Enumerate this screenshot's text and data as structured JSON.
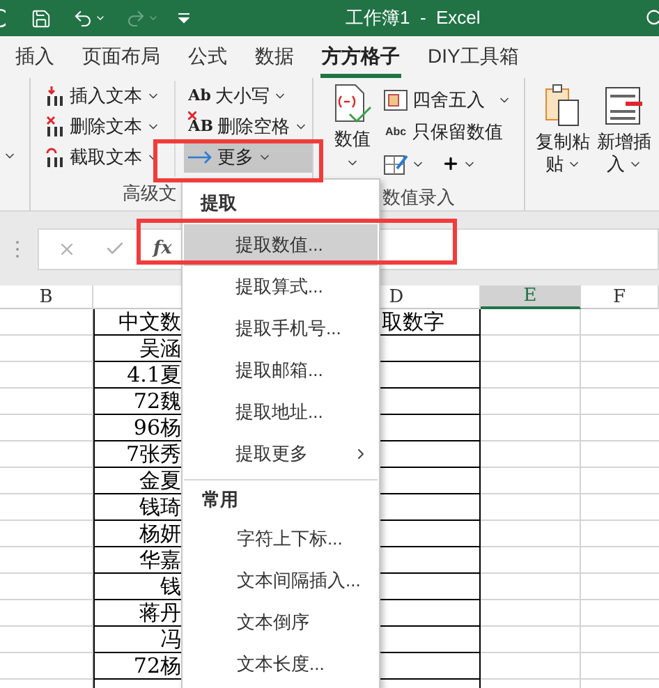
{
  "title_bar": {
    "title": "工作簿1  -  Excel"
  },
  "tabs": [
    {
      "label": "插入",
      "selected": false
    },
    {
      "label": "页面布局",
      "selected": false
    },
    {
      "label": "公式",
      "selected": false
    },
    {
      "label": "数据",
      "selected": false
    },
    {
      "label": "方方格子",
      "selected": true
    },
    {
      "label": "DIY工具箱",
      "selected": false
    }
  ],
  "ribbon": {
    "text_group": {
      "label": "高级文",
      "columns": [
        [
          {
            "label": "插入文本",
            "dropdown": true,
            "pressed": false
          },
          {
            "label": "删除文本",
            "dropdown": true,
            "pressed": false
          },
          {
            "label": "截取文本",
            "dropdown": true,
            "pressed": false
          }
        ],
        [
          {
            "label": "大小写",
            "icon_text": "Ab",
            "dropdown": true,
            "pressed": false
          },
          {
            "label": "删除空格",
            "icon_text": "AB",
            "dropdown": true,
            "pressed": false
          },
          {
            "label": "更多",
            "dropdown": true,
            "pressed": true
          }
        ]
      ]
    },
    "number_group": {
      "label": "数值录入",
      "big_button": {
        "label": "数值",
        "dropdown": true
      },
      "items": [
        {
          "label": "四舍五入",
          "dropdown": true
        },
        {
          "label": "只保留数值",
          "icon_text": "Abc",
          "dropdown": false
        }
      ]
    },
    "clipboard_group": {
      "buttons": [
        {
          "lines": [
            "复制粘",
            "贴"
          ],
          "dropdown": true
        },
        {
          "lines": [
            "新增插",
            "入"
          ],
          "dropdown": true
        }
      ]
    }
  },
  "formula_bar": {
    "function_label": "fx"
  },
  "sheet": {
    "columns": [
      {
        "label": "B",
        "selected": false
      },
      {
        "label": "D",
        "selected": false
      },
      {
        "label": "E",
        "selected": true
      },
      {
        "label": "F",
        "selected": false
      }
    ],
    "rows": [
      {
        "c": "中文数",
        "d": "取数字"
      },
      {
        "c": "吴涵"
      },
      {
        "c": "4.1夏"
      },
      {
        "c": "72魏"
      },
      {
        "c": "96杨"
      },
      {
        "c": "7张秀"
      },
      {
        "c": "金夏"
      },
      {
        "c": "钱琦"
      },
      {
        "c": "杨妍"
      },
      {
        "c": "华嘉"
      },
      {
        "c": "钱"
      },
      {
        "c": "蒋丹"
      },
      {
        "c": "冯"
      },
      {
        "c": "72杨"
      },
      {}
    ]
  },
  "menu": {
    "sections": [
      {
        "header": "提取",
        "items": [
          {
            "label": "提取数值...",
            "highlighted": true,
            "submenu": false
          },
          {
            "label": "提取算式...",
            "highlighted": false,
            "submenu": false
          },
          {
            "label": "提取手机号...",
            "highlighted": false,
            "submenu": false
          },
          {
            "label": "提取邮箱...",
            "highlighted": false,
            "submenu": false
          },
          {
            "label": "提取地址...",
            "highlighted": false,
            "submenu": false
          },
          {
            "label": "提取更多",
            "highlighted": false,
            "submenu": true
          }
        ]
      },
      {
        "header": "常用",
        "items": [
          {
            "label": "字符上下标...",
            "highlighted": false,
            "submenu": false
          },
          {
            "label": "文本间隔插入...",
            "highlighted": false,
            "submenu": false
          },
          {
            "label": "文本倒序",
            "highlighted": false,
            "submenu": false
          },
          {
            "label": "文本长度...",
            "highlighted": false,
            "submenu": false
          }
        ]
      }
    ]
  }
}
